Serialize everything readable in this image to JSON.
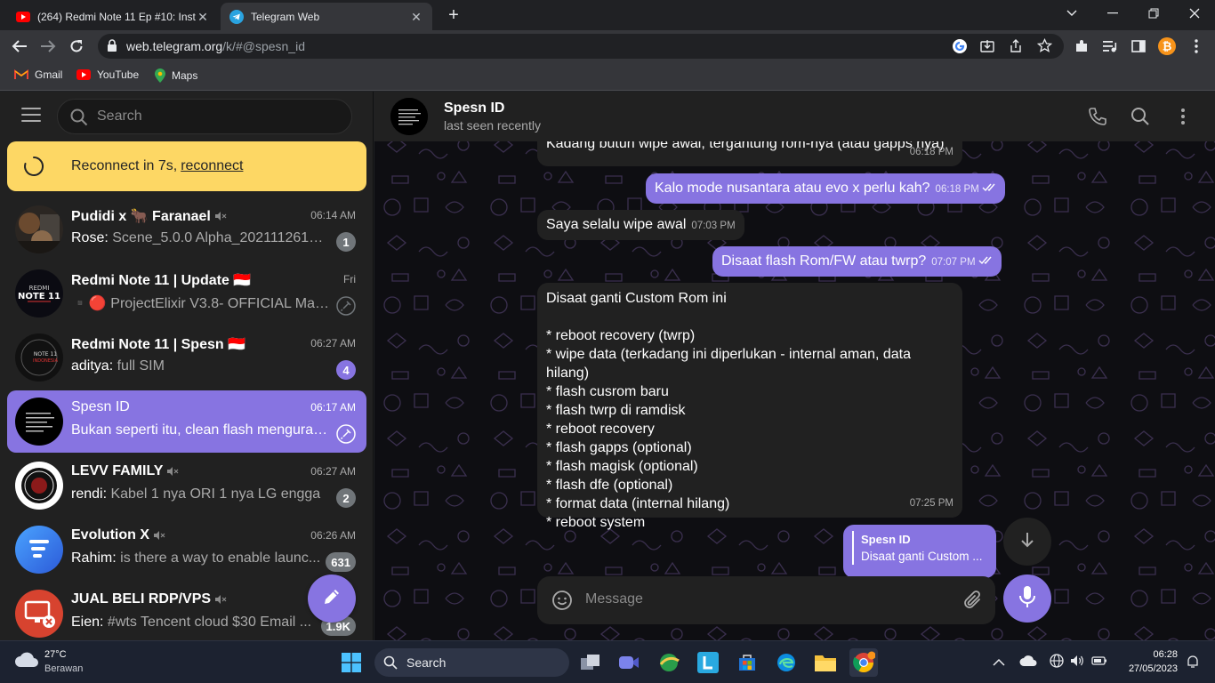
{
  "browser": {
    "tabs": [
      {
        "title": "(264) Redmi Note 11 Ep #10: Inst",
        "icon": "youtube-icon"
      },
      {
        "title": "Telegram Web",
        "icon": "telegram-icon"
      }
    ],
    "url_host": "web.telegram.org",
    "url_rest": "/k/#@spesn_id",
    "bookmarks": [
      {
        "label": "Gmail",
        "icon": "gmail-icon"
      },
      {
        "label": "YouTube",
        "icon": "youtube-icon"
      },
      {
        "label": "Maps",
        "icon": "maps-icon"
      }
    ]
  },
  "sidebar": {
    "search_placeholder": "Search",
    "reconnect_text": "Reconnect in 7s,",
    "reconnect_link": "reconnect",
    "chats": [
      {
        "name": "Pudidi x 🐂 Faranael",
        "time": "06:14 AM",
        "sender": "Rose:",
        "preview": "Scene_5.0.0 Alpha_202111261_r...",
        "badge": "1",
        "muted": true
      },
      {
        "name": "Redmi Note 11 | Update 🇮🇩",
        "time": "Fri",
        "sender": "",
        "preview": "▪️🔴 ProjectElixir V3.8- OFFICIAL Maintai...",
        "badge": "",
        "pinned": true
      },
      {
        "name": "Redmi Note 11 | Spesn 🇮🇩",
        "time": "06:27 AM",
        "sender": "aditya:",
        "preview": "full SIM",
        "badge": "4",
        "accent": true
      },
      {
        "name": "Spesn ID",
        "time": "06:17 AM",
        "sender": "",
        "preview": "Bukan seperti itu, clean flash menguran...",
        "badge": "",
        "pinned": true,
        "selected": true
      },
      {
        "name": "LEVV FAMILY",
        "time": "06:27 AM",
        "sender": "rendi:",
        "preview": "Kabel 1 nya ORI 1 nya LG engga",
        "badge": "2",
        "muted": true
      },
      {
        "name": "Evolution X",
        "time": "06:26 AM",
        "sender": "Rahim:",
        "preview": "is there a way to enable launc...",
        "badge": "631",
        "muted": true
      },
      {
        "name": "JUAL BELI RDP/VPS",
        "time": "",
        "sender": "Eien:",
        "preview": "#wts Tencent cloud $30 Email ...",
        "badge": "1.9K",
        "muted": true
      }
    ]
  },
  "chat": {
    "title": "Spesn ID",
    "status": "last seen recently",
    "messages": [
      {
        "dir": "in",
        "text": "Kadang butuh wipe awal, tergantung rom-nya (atau gapps nya)",
        "time": "06:18 PM"
      },
      {
        "dir": "out",
        "text": "Kalo mode nusantara atau evo x perlu kah?",
        "time": "06:18 PM"
      },
      {
        "dir": "in",
        "text": "Saya selalu wipe awal",
        "time": "07:03 PM"
      },
      {
        "dir": "out",
        "text": "Disaat flash Rom/FW atau twrp?",
        "time": "07:07 PM"
      },
      {
        "dir": "in",
        "lines": [
          "Disaat ganti Custom Rom ini",
          "",
          "* reboot recovery (twrp)",
          "* wipe data (terkadang ini diperlukan - internal aman, data hilang)",
          "* flash cusrom baru",
          "* flash twrp di ramdisk",
          "* reboot recovery",
          "* flash gapps (optional)",
          "* flash magisk (optional)",
          "* flash dfe (optional)",
          "* format data (internal hilang)",
          "* reboot system"
        ],
        "time": "07:25 PM"
      },
      {
        "dir": "out",
        "reply_name": "Spesn ID",
        "reply_text": "Disaat ganti Custom ..."
      }
    ],
    "composer_placeholder": "Message"
  },
  "taskbar": {
    "weather_temp": "27°C",
    "weather_desc": "Berawan",
    "search_label": "Search",
    "time": "06:28",
    "date": "27/05/2023"
  },
  "colors": {
    "accent": "#8774e1",
    "reconnect_bg": "#fdd764",
    "sidebar_bg": "#212121"
  }
}
